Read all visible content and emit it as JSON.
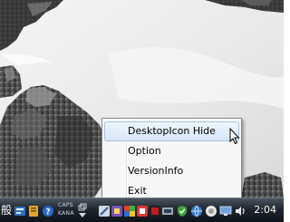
{
  "context_menu": {
    "items": [
      {
        "label": "DesktopIcon Hide",
        "state": "highlighted"
      },
      {
        "label": "Option",
        "state": "normal"
      },
      {
        "label": "VersionInfo",
        "state": "normal"
      },
      {
        "label": "Exit",
        "state": "normal"
      }
    ]
  },
  "taskbar": {
    "ime_char": "般",
    "caps_label": "CAPS",
    "kana_label": "KANA",
    "clock": "2:04",
    "tray_icons": [
      "ime-toolbar-icon",
      "dictionary-icon",
      "help-icon",
      "tool-icon",
      "app-icon",
      "flag-icon",
      "color-icon",
      "security-icon",
      "network-icon",
      "shield-check-icon",
      "globe-icon",
      "sound-icon",
      "monitor-icon"
    ]
  },
  "colors": {
    "menu_background": "#f7f7f7",
    "menu_highlight": "#d7e7f8",
    "menu_highlight_border": "#a6c3e3",
    "taskbar": "#1f262e",
    "clock_text": "#ffffff"
  }
}
